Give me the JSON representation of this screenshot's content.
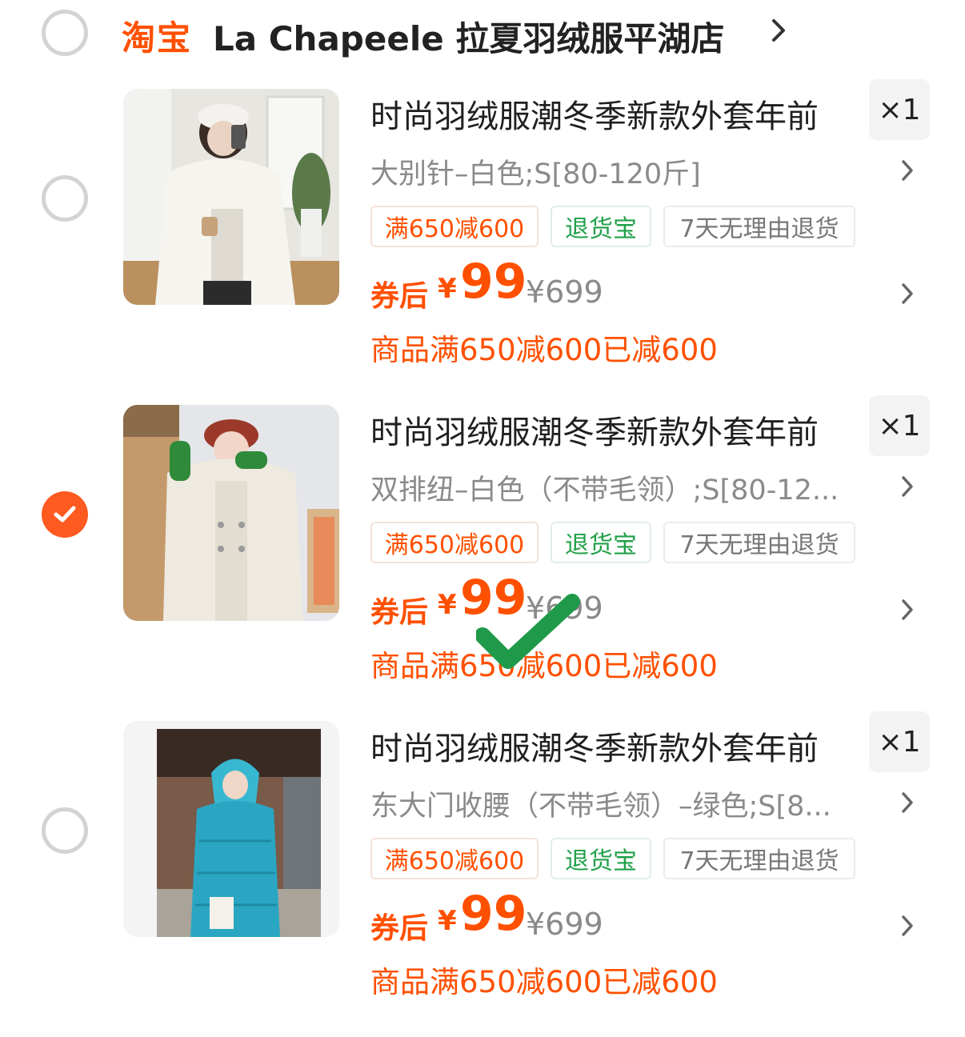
{
  "store": {
    "logo_text": "淘宝",
    "name": "La Chapeele 拉夏羽绒服平湖店"
  },
  "items": [
    {
      "title": "时尚羽绒服潮冬季新款外套年前",
      "quantity": "×1",
      "sku": "大别针–白色;S[80-120斤]",
      "tags": [
        "满650减600",
        "退货宝",
        "7天无理由退货"
      ],
      "coupon_label": "券后",
      "currency": "¥",
      "price": "99",
      "original_price": "¥699",
      "discount_note": "商品满650减600已减600",
      "selected": false
    },
    {
      "title": "时尚羽绒服潮冬季新款外套年前",
      "quantity": "×1",
      "sku": "双排纽–白色（不带毛领）;S[80-12...",
      "tags": [
        "满650减600",
        "退货宝",
        "7天无理由退货"
      ],
      "coupon_label": "券后",
      "currency": "¥",
      "price": "99",
      "original_price": "¥699",
      "discount_note": "商品满650减600已减600",
      "selected": true
    },
    {
      "title": "时尚羽绒服潮冬季新款外套年前",
      "quantity": "×1",
      "sku": "东大门收腰（不带毛领）–绿色;S[8...",
      "tags": [
        "满650减600",
        "退货宝",
        "7天无理由退货"
      ],
      "coupon_label": "券后",
      "currency": "¥",
      "price": "99",
      "original_price": "¥699",
      "discount_note": "商品满650减600已减600",
      "selected": false
    }
  ],
  "colors": {
    "accent": "#ff5000",
    "selected_radio": "#ff5a1f",
    "return_tag": "#21a04a",
    "overlay_check": "#1f9a4a"
  },
  "icons": [
    "chevron-right-icon",
    "check-icon",
    "green-checkmark-icon"
  ]
}
